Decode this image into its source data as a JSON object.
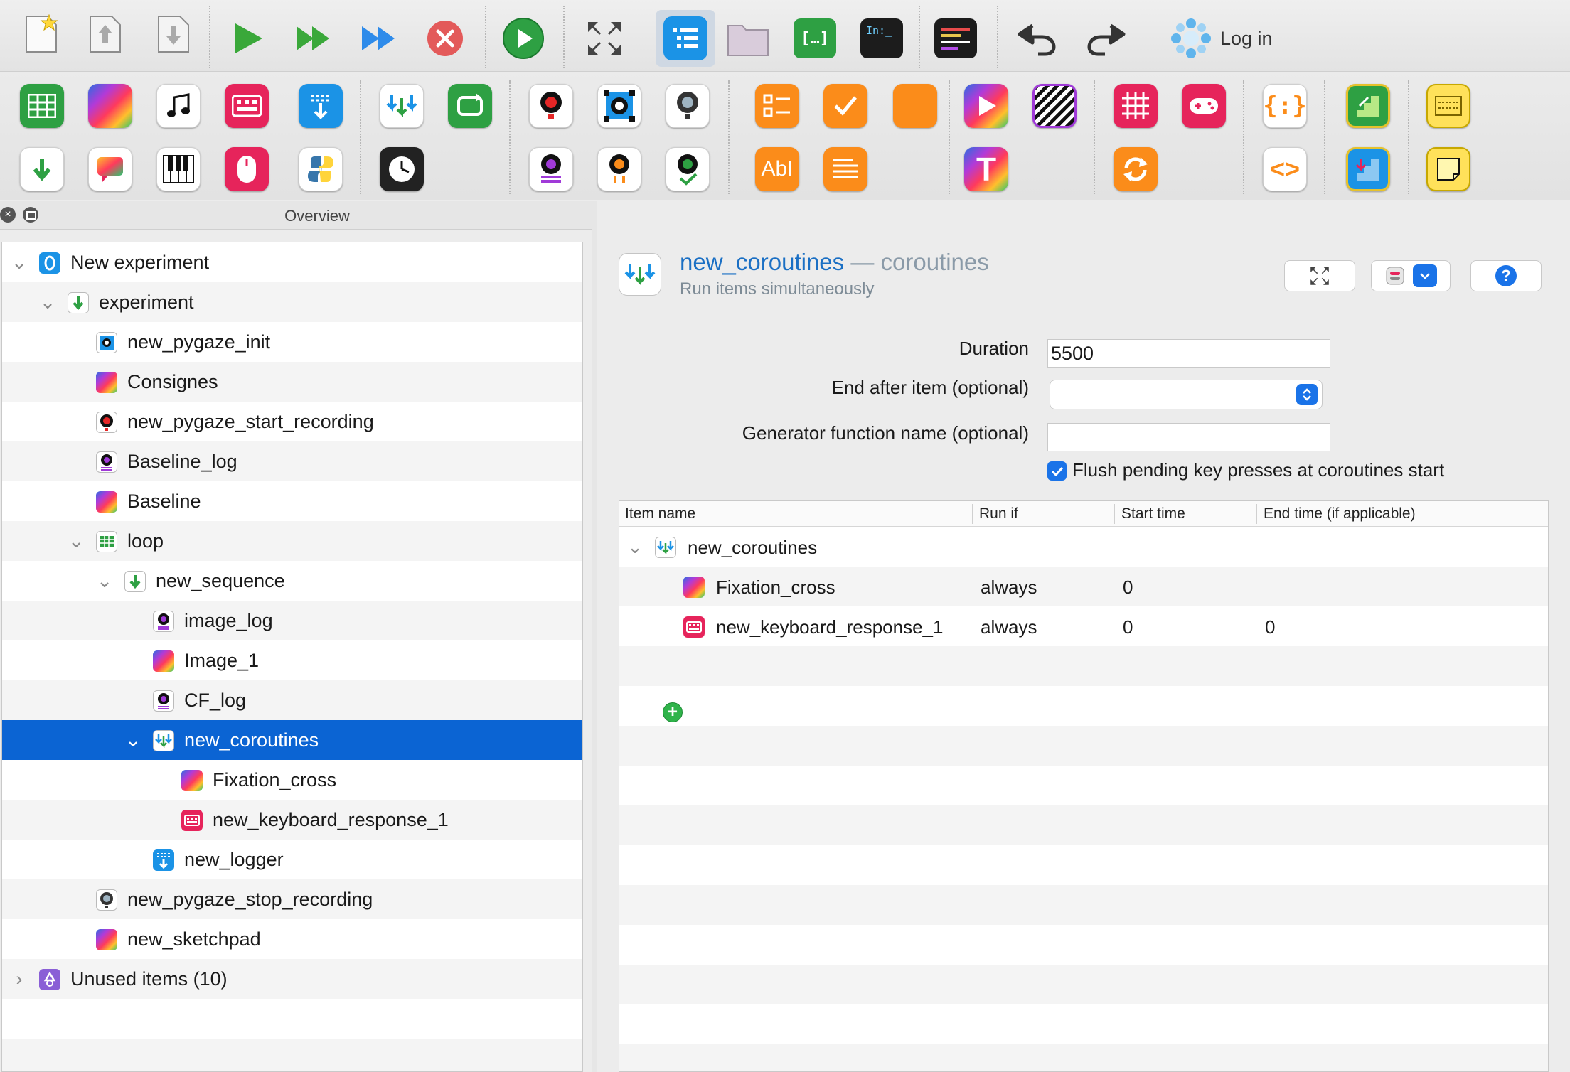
{
  "toolbar": {
    "login_label": "Log in",
    "main_buttons": [
      "new-experiment",
      "save",
      "open",
      "run",
      "run-quick",
      "run-in-window",
      "kill",
      "run-jupyter",
      "fullscreen",
      "overview-toggle",
      "file-pool",
      "debug-window",
      "console",
      "color-palette",
      "undo",
      "redo"
    ]
  },
  "item_toolbar": {
    "row1": [
      "loop",
      "sketchpad",
      "sampler",
      "keyboard_response",
      "logger",
      "coroutines",
      "sequence",
      "pygaze_start_recording",
      "pygaze_init",
      "pygaze_stop_recording",
      "form_multiple_choice",
      "form_consent",
      "form_base",
      "media_player",
      "advanced_delay",
      "touch_response",
      "joystick",
      "inline_javascript",
      "notepad",
      "reset_feedback",
      "text_display"
    ],
    "row2": [
      "sequence",
      "feedback",
      "synth",
      "mouse_response",
      "inline_script",
      "advanced_clock",
      "pygaze_log",
      "pygaze_drift_correct",
      "pygaze_wait",
      "form_text_input",
      "form_text_display",
      "text_input",
      "repeat_cycle",
      "inline_html",
      "parallel_port",
      "notepad_yellow"
    ],
    "text_input_glyph": "AbI",
    "text_display_glyph": "T"
  },
  "overview": {
    "title": "Overview",
    "rows": [
      {
        "label": "New experiment",
        "icon": "experiment-root-icon",
        "depth": 0,
        "expanded": true
      },
      {
        "label": "experiment",
        "icon": "sequence-icon",
        "depth": 1,
        "expanded": true
      },
      {
        "label": "new_pygaze_init",
        "icon": "pygaze-init-icon",
        "depth": 2
      },
      {
        "label": "Consignes",
        "icon": "sketchpad-icon",
        "depth": 2
      },
      {
        "label": "new_pygaze_start_recording",
        "icon": "pygaze-start-recording-icon",
        "depth": 2
      },
      {
        "label": "Baseline_log",
        "icon": "pygaze-log-icon",
        "depth": 2
      },
      {
        "label": "Baseline",
        "icon": "sketchpad-icon",
        "depth": 2
      },
      {
        "label": "loop",
        "icon": "loop-icon",
        "depth": 2,
        "expanded": true
      },
      {
        "label": "new_sequence",
        "icon": "sequence-icon",
        "depth": 3,
        "expanded": true
      },
      {
        "label": "image_log",
        "icon": "pygaze-log-icon",
        "depth": 4
      },
      {
        "label": "Image_1",
        "icon": "sketchpad-icon",
        "depth": 4
      },
      {
        "label": "CF_log",
        "icon": "pygaze-log-icon",
        "depth": 4
      },
      {
        "label": "new_coroutines",
        "icon": "coroutines-icon",
        "depth": 4,
        "expanded": true,
        "selected": true
      },
      {
        "label": "Fixation_cross",
        "icon": "sketchpad-icon",
        "depth": 5
      },
      {
        "label": "new_keyboard_response_1",
        "icon": "keyboard-response-icon",
        "depth": 5
      },
      {
        "label": "new_logger",
        "icon": "logger-icon",
        "depth": 4
      },
      {
        "label": "new_pygaze_stop_recording",
        "icon": "pygaze-stop-recording-icon",
        "depth": 2
      },
      {
        "label": "new_sketchpad",
        "icon": "sketchpad-icon",
        "depth": 2
      },
      {
        "label": "Unused items (10)",
        "icon": "unused-items-icon",
        "depth": 0,
        "expanded": false
      }
    ]
  },
  "editor": {
    "item_name": "new_coroutines",
    "separator": " — ",
    "item_type": "coroutines",
    "description": "Run items simultaneously",
    "duration_label": "Duration",
    "duration_value": "5500",
    "end_after_label": "End after item (optional)",
    "end_after_value": "",
    "generator_label": "Generator function name (optional)",
    "generator_value": "",
    "flush_label": "Flush pending key presses at coroutines start",
    "flush_checked": true,
    "table": {
      "headers": [
        "Item name",
        "Run if",
        "Start time",
        "End time (if applicable)"
      ],
      "root": "new_coroutines",
      "rows": [
        {
          "name": "Fixation_cross",
          "icon": "sketchpad-icon",
          "run_if": "always",
          "start": "0",
          "end": ""
        },
        {
          "name": "new_keyboard_response_1",
          "icon": "keyboard-response-icon",
          "run_if": "always",
          "start": "0",
          "end": "0"
        }
      ]
    }
  },
  "colors": {
    "selection": "#0b64d3",
    "title_blue": "#1a6fc4",
    "accent": "#1a73e8"
  }
}
